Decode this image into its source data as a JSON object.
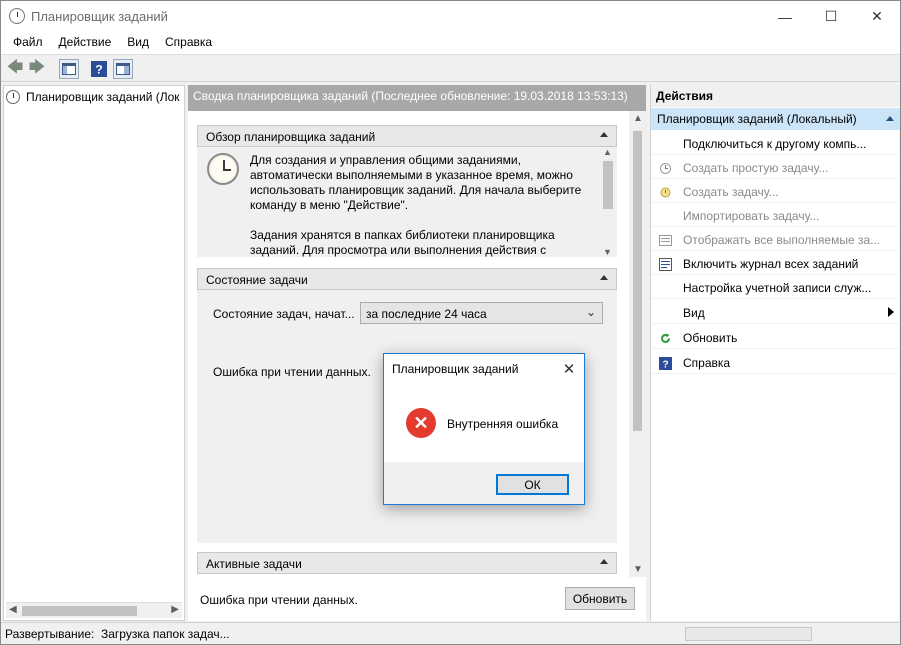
{
  "window": {
    "title": "Планировщик заданий",
    "minimize": "—",
    "maximize": "☐",
    "close": "✕"
  },
  "menu": [
    "Файл",
    "Действие",
    "Вид",
    "Справка"
  ],
  "toolbar": {
    "back": "🡄",
    "forward": "🡆",
    "help": "?"
  },
  "tree": {
    "item": "Планировщик заданий (Лок"
  },
  "center": {
    "header": "Сводка планировщика заданий (Последнее обновление: 19.03.2018 13:53:13)",
    "overview": {
      "title": "Обзор планировщика заданий",
      "paragraph1": "Для создания и управления общими заданиями, автоматически выполняемыми в указанное время, можно использовать планировщик заданий. Для начала выберите команду в меню \"Действие\".",
      "paragraph2": "Задания хранятся в папках библиотеки планировщика заданий. Для просмотра или выполнения действия с"
    },
    "status": {
      "title": "Состояние задачи",
      "label": "Состояние задач, начат...",
      "period": "за последние 24 часа",
      "error": "Ошибка при чтении данных."
    },
    "active": {
      "title": "Активные задачи",
      "error": "Ошибка при чтении данных.",
      "refresh": "Обновить"
    }
  },
  "actions": {
    "header": "Действия",
    "group": "Планировщик заданий (Локальный)",
    "items": [
      {
        "label": "Подключиться к другому компь...",
        "icon": "",
        "enabled": true
      },
      {
        "label": "Создать простую задачу...",
        "icon": "wand-icon",
        "enabled": false
      },
      {
        "label": "Создать задачу...",
        "icon": "task-icon",
        "enabled": false
      },
      {
        "label": "Импортировать задачу...",
        "icon": "",
        "enabled": false
      },
      {
        "label": "Отображать все выполняемые за...",
        "icon": "list-icon",
        "enabled": false
      },
      {
        "label": "Включить журнал всех заданий",
        "icon": "log-icon",
        "enabled": true
      },
      {
        "label": "Настройка учетной записи служ...",
        "icon": "",
        "enabled": true
      },
      {
        "label": "Вид",
        "icon": "",
        "enabled": true
      },
      {
        "label": "Обновить",
        "icon": "refresh-icon",
        "enabled": true
      },
      {
        "label": "Справка",
        "icon": "help-icon",
        "enabled": true
      }
    ]
  },
  "statusbar": {
    "text": "Развертывание:  Загрузка папок задач..."
  },
  "dialog": {
    "title": "Планировщик заданий",
    "message": "Внутренняя ошибка",
    "ok": "ОК",
    "close": "✕",
    "icon": "✕"
  }
}
